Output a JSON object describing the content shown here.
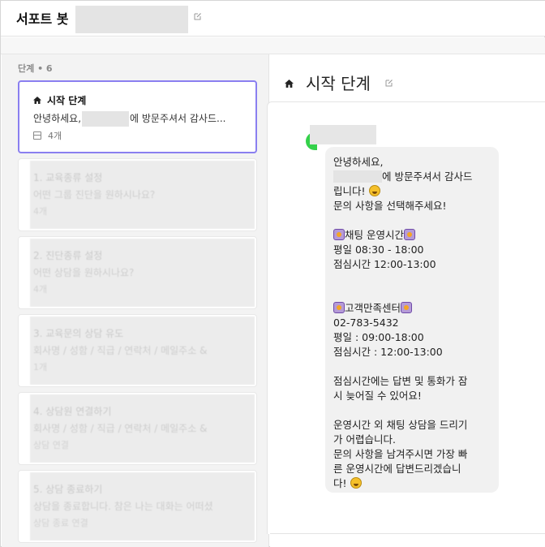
{
  "header": {
    "title": "서포트 봇"
  },
  "steps_label": "단계 • 6",
  "cards": [
    {
      "title": "시작 단계",
      "body_pre": "안녕하세요,",
      "body_post": "에 방문주셔서 감사드...",
      "meta": "4개"
    },
    {
      "title": "1. 교육종류 설정",
      "body": "어떤 그룹 진단을 원하시나요?",
      "meta": "4개"
    },
    {
      "title": "2. 진단종류 설정",
      "body": "어떤 상담을 원하시나요?",
      "meta": "4개"
    },
    {
      "title": "3. 교육문의 상담 유도",
      "body": "회사명 / 성함 / 직급 / 연락처 / 메일주소 &",
      "meta": "1개"
    },
    {
      "title": "4. 상담원 연결하기",
      "body": "회사명 / 성함 / 직급 / 연락처 / 메일주소 &",
      "meta": "상담 연결"
    },
    {
      "title": "5. 상담 종료하기",
      "body": "상담을 종료합니다. 참은 나는 대화는 어떠셨",
      "meta": "상담 종료 연결"
    }
  ],
  "detail": {
    "title": "시작 단계",
    "message_lines": [
      {
        "text": "안녕하세요,"
      },
      {
        "redact_pre": true,
        "text": "에 방문주셔서 감사드"
      },
      {
        "text": "립니다! ",
        "emoji_after": "grin"
      },
      {
        "text": "문의 사항을 선택해주세요!"
      },
      {
        "text": ""
      },
      {
        "emoji_before": "mark",
        "text": "채팅 운영시간",
        "emoji_after": "mark"
      },
      {
        "text": "평일 08:30 - 18:00"
      },
      {
        "text": "점심시간 12:00-13:00"
      },
      {
        "text": ""
      },
      {
        "text": ""
      },
      {
        "emoji_before": "mark",
        "text": "고객만족센터",
        "emoji_after": "mark"
      },
      {
        "text": "02-783-5432"
      },
      {
        "text": "평일 : 09:00-18:00"
      },
      {
        "text": "점심시간 : 12:00-13:00"
      },
      {
        "text": ""
      },
      {
        "text": "점심시간에는 답변 및 통화가 잠"
      },
      {
        "text": "시 늦어질 수 있어요!"
      },
      {
        "text": ""
      },
      {
        "text": "운영시간 외 채팅 상담을 드리기"
      },
      {
        "text": "가 어렵습니다."
      },
      {
        "text": "문의 사항을 남겨주시면 가장 빠"
      },
      {
        "text": "른 운영시간에 답변드리겠습니"
      },
      {
        "text": "다! ",
        "emoji_after": "grin"
      }
    ]
  },
  "colors": {
    "accent": "#8a7ff0",
    "bot": "#34d14a"
  }
}
